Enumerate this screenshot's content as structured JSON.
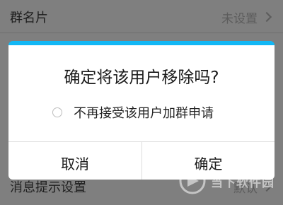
{
  "background": {
    "top_row": {
      "label": "群名片",
      "value": "未设置"
    },
    "bottom_row": {
      "label": "消息提示设置",
      "value": "默认"
    }
  },
  "dialog": {
    "title": "确定将该用户移除吗?",
    "option_label": "不再接受该用户加群申请",
    "option_checked": false,
    "cancel_label": "取消",
    "confirm_label": "确定",
    "accent_color": "#12b7f5"
  },
  "watermark": {
    "text": "当下软件园"
  }
}
